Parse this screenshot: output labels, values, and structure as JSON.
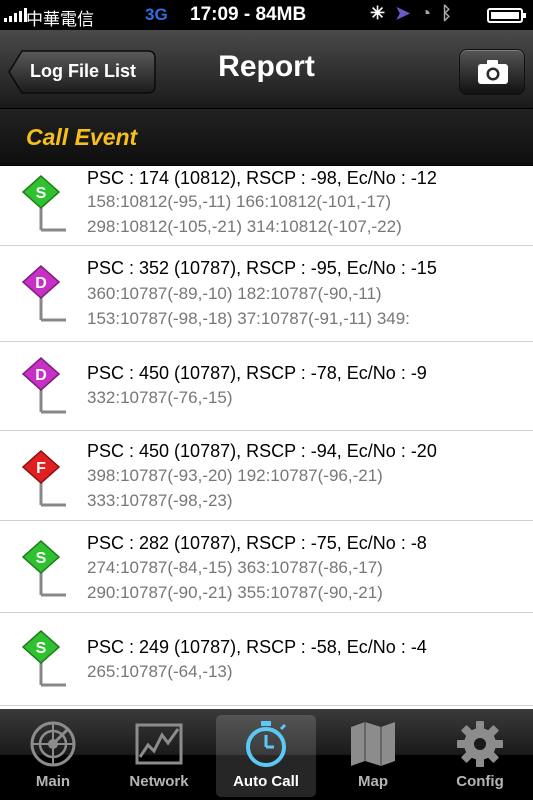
{
  "status_bar": {
    "carrier": "中華電信",
    "network": "3G",
    "time": "17:09 - 84MB"
  },
  "nav": {
    "back_label": "Log File List",
    "title": "Report"
  },
  "section": {
    "title": "Call Event"
  },
  "events": [
    {
      "pin": "S",
      "pin_color": "#2fc12f",
      "primary": "PSC : 174 (10812), RSCP : -98, Ec/No : -12",
      "sub": [
        "158:10812(-95,-11)   166:10812(-101,-17)",
        "298:10812(-105,-21)   314:10812(-107,-22)"
      ]
    },
    {
      "pin": "D",
      "pin_color": "#c431c4",
      "primary": "PSC : 352 (10787), RSCP : -95, Ec/No : -15",
      "sub": [
        "360:10787(-89,-10)   182:10787(-90,-11)",
        "153:10787(-98,-18)   37:10787(-91,-11)   349:"
      ]
    },
    {
      "pin": "D",
      "pin_color": "#c431c4",
      "primary": "PSC : 450 (10787), RSCP : -78, Ec/No : -9",
      "sub": [
        "332:10787(-76,-15)"
      ]
    },
    {
      "pin": "F",
      "pin_color": "#e02020",
      "primary": "PSC : 450 (10787), RSCP : -94, Ec/No : -20",
      "sub": [
        "398:10787(-93,-20)   192:10787(-96,-21)",
        "333:10787(-98,-23)"
      ]
    },
    {
      "pin": "S",
      "pin_color": "#2fc12f",
      "primary": "PSC : 282 (10787), RSCP : -75, Ec/No : -8",
      "sub": [
        "274:10787(-84,-15)   363:10787(-86,-17)",
        "290:10787(-90,-21)   355:10787(-90,-21)"
      ]
    },
    {
      "pin": "S",
      "pin_color": "#2fc12f",
      "primary": "PSC : 249 (10787), RSCP : -58, Ec/No : -4",
      "sub": [
        "265:10787(-64,-13)"
      ]
    }
  ],
  "tabs": [
    {
      "label": "Main",
      "icon": "radar-icon"
    },
    {
      "label": "Network",
      "icon": "network-graph-icon"
    },
    {
      "label": "Auto Call",
      "icon": "stopwatch-icon",
      "active": true
    },
    {
      "label": "Map",
      "icon": "map-icon"
    },
    {
      "label": "Config",
      "icon": "gear-icon"
    }
  ]
}
